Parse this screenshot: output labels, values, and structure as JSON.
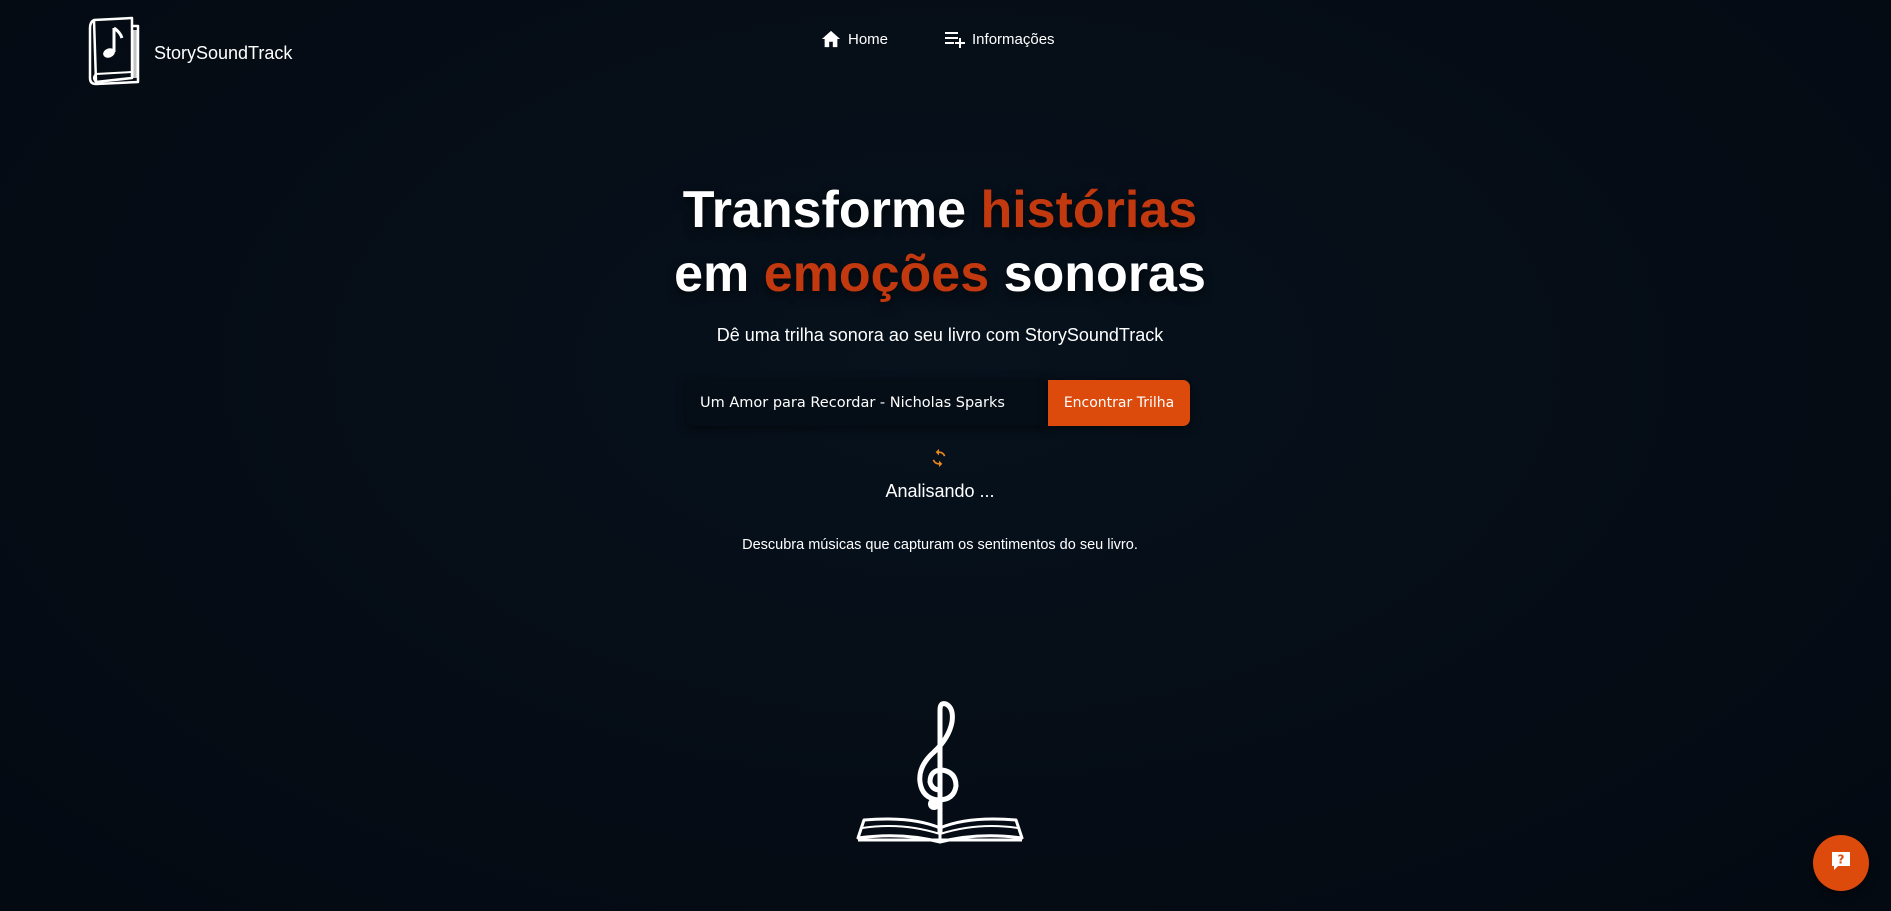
{
  "header": {
    "brand": "StorySoundTrack",
    "logo_icon": "book-music-icon",
    "nav": [
      {
        "label": "Home",
        "icon": "home-icon"
      },
      {
        "label": "Informações",
        "icon": "playlist-add-icon"
      }
    ]
  },
  "hero": {
    "title_line1_part1": "Transforme ",
    "title_line1_accent": "histórias",
    "title_line2_part1": "em ",
    "title_line2_accent": "emoções",
    "title_line2_part2": " sonoras",
    "subtitle": "Dê uma trilha sonora ao seu livro com StorySoundTrack"
  },
  "search": {
    "value": "Um Amor para Recordar - Nicholas Sparks",
    "button_label": "Encontrar Trilha"
  },
  "status": {
    "icon": "sync-icon",
    "text": "Analisando ..."
  },
  "tagline": "Descubra músicas que capturam os sentimentos do seu livro.",
  "illustration": "treble-clef-book-icon",
  "help": {
    "icon": "help-question-icon"
  },
  "colors": {
    "background": "#050d16",
    "accent": "#c2380f",
    "button": "#dc4a0c",
    "spinner": "#e8871e"
  }
}
